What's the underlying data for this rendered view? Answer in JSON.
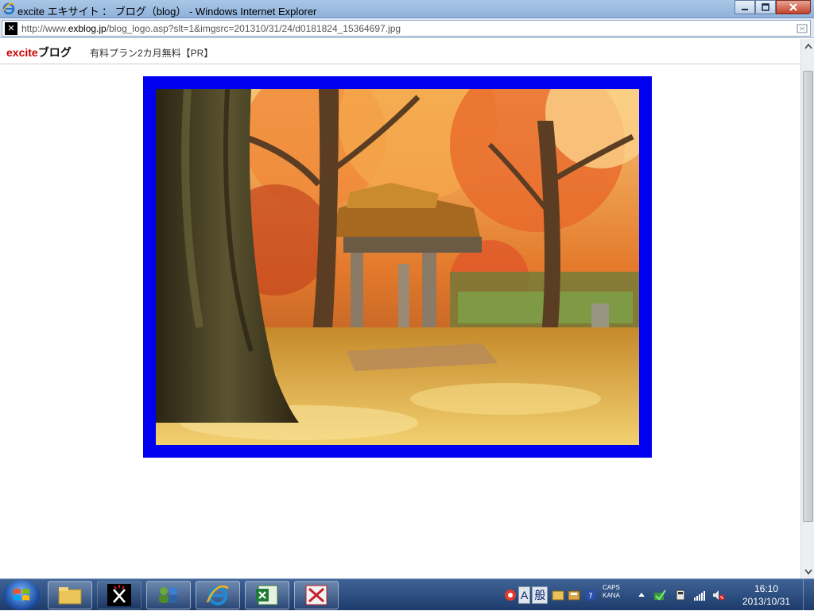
{
  "window": {
    "title": "excite エキサイト ： ブログ（blog） - Windows Internet Explorer",
    "address_prefix": "http://www.",
    "address_domain": "exblog.jp",
    "address_rest": "/blog_logo.asp?slt=1&imgsrc=201310/31/24/d0181824_15364697.jpg"
  },
  "page": {
    "logo_excite": "excite",
    "logo_blog": "ブログ",
    "pr_text": "有料プラン2カ月無料【PR】",
    "photo_frame_color": "#0000f0"
  },
  "taskbar": {
    "ime_a": "A",
    "ime_mode": "般",
    "caps": "CAPS",
    "kana": "KANA",
    "clock_time": "16:10",
    "clock_date": "2013/10/31"
  },
  "icons": [
    "ie-icon",
    "minimize-icon",
    "maximize-icon",
    "close-icon",
    "site-favicon",
    "compatibility-view-icon",
    "start-orb-icon",
    "explorer-folder-icon",
    "excite-app-icon",
    "network-users-icon",
    "internet-explorer-icon",
    "excel-icon",
    "app-red-icon",
    "scroll-up-icon",
    "scroll-down-icon"
  ]
}
